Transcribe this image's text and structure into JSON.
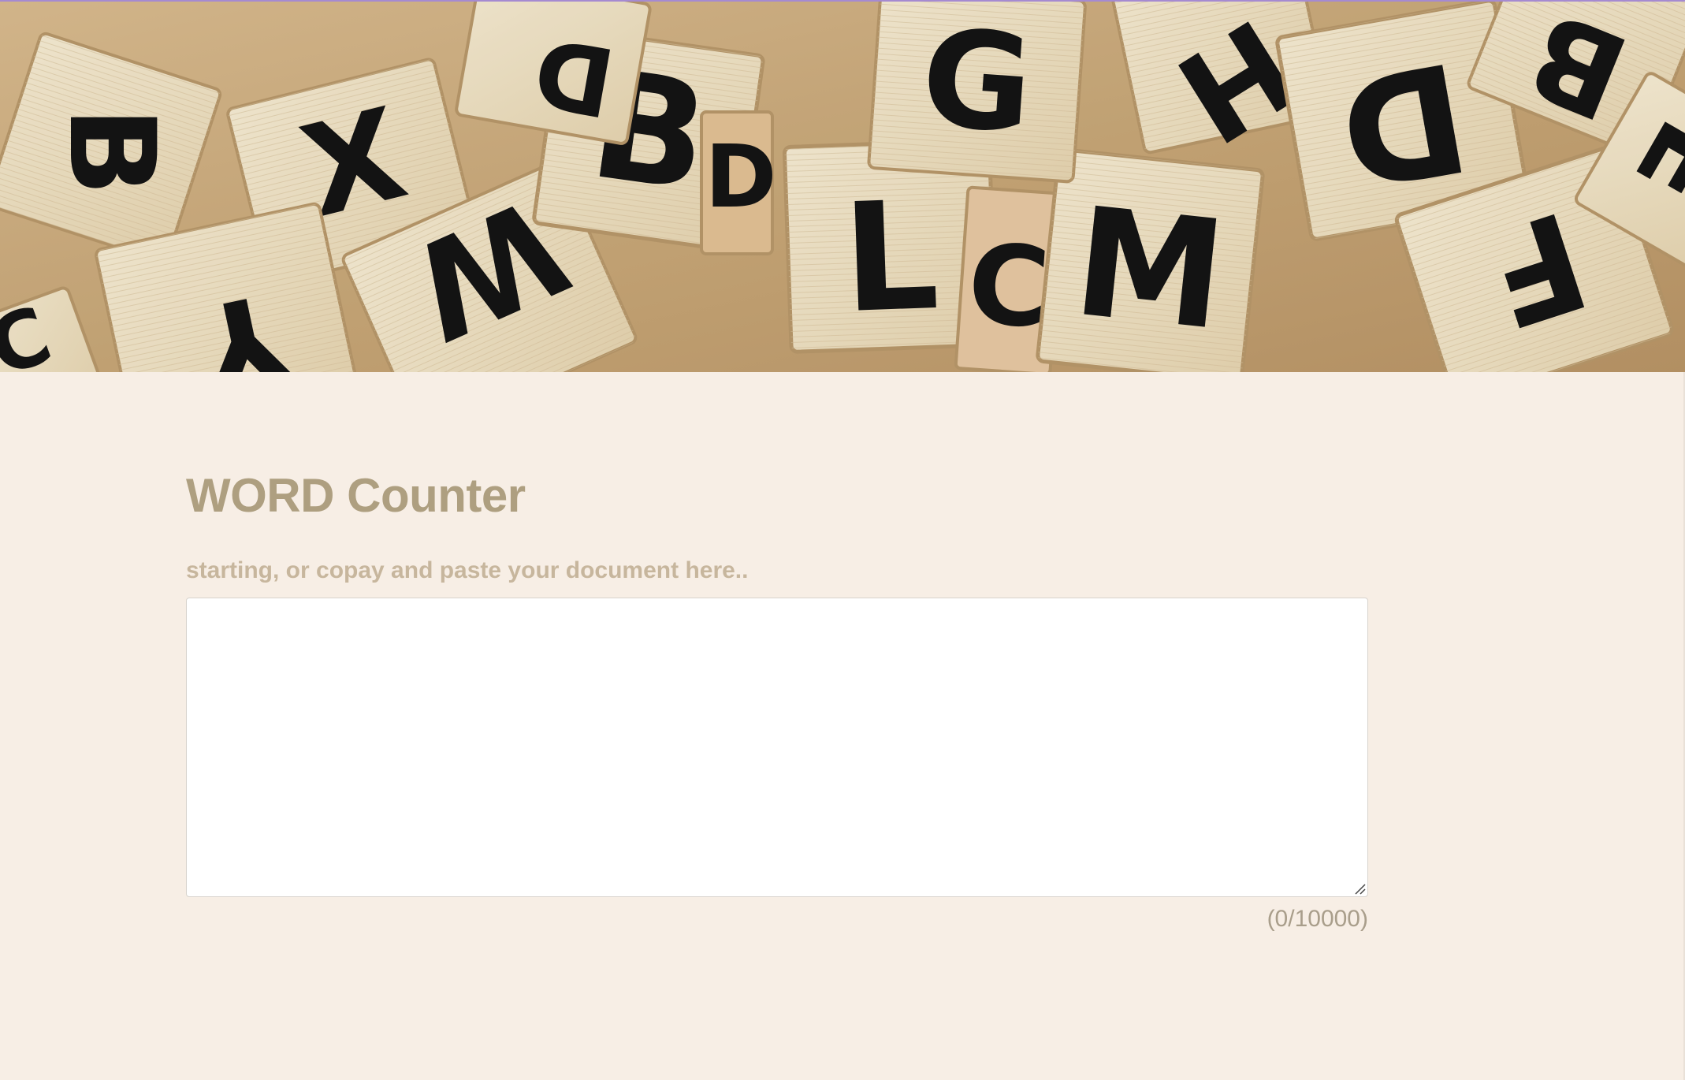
{
  "hero": {
    "tiles": [
      "B",
      "X",
      "W",
      "Y",
      "B",
      "L",
      "C",
      "M",
      "G",
      "H",
      "D",
      "B",
      "F",
      "E",
      "D",
      "D",
      "C"
    ]
  },
  "main": {
    "title": "WORD Counter",
    "prompt": "starting, or copay and paste your document here..",
    "textarea": {
      "value": "",
      "placeholder": ""
    },
    "counter": "(0/10000)"
  }
}
